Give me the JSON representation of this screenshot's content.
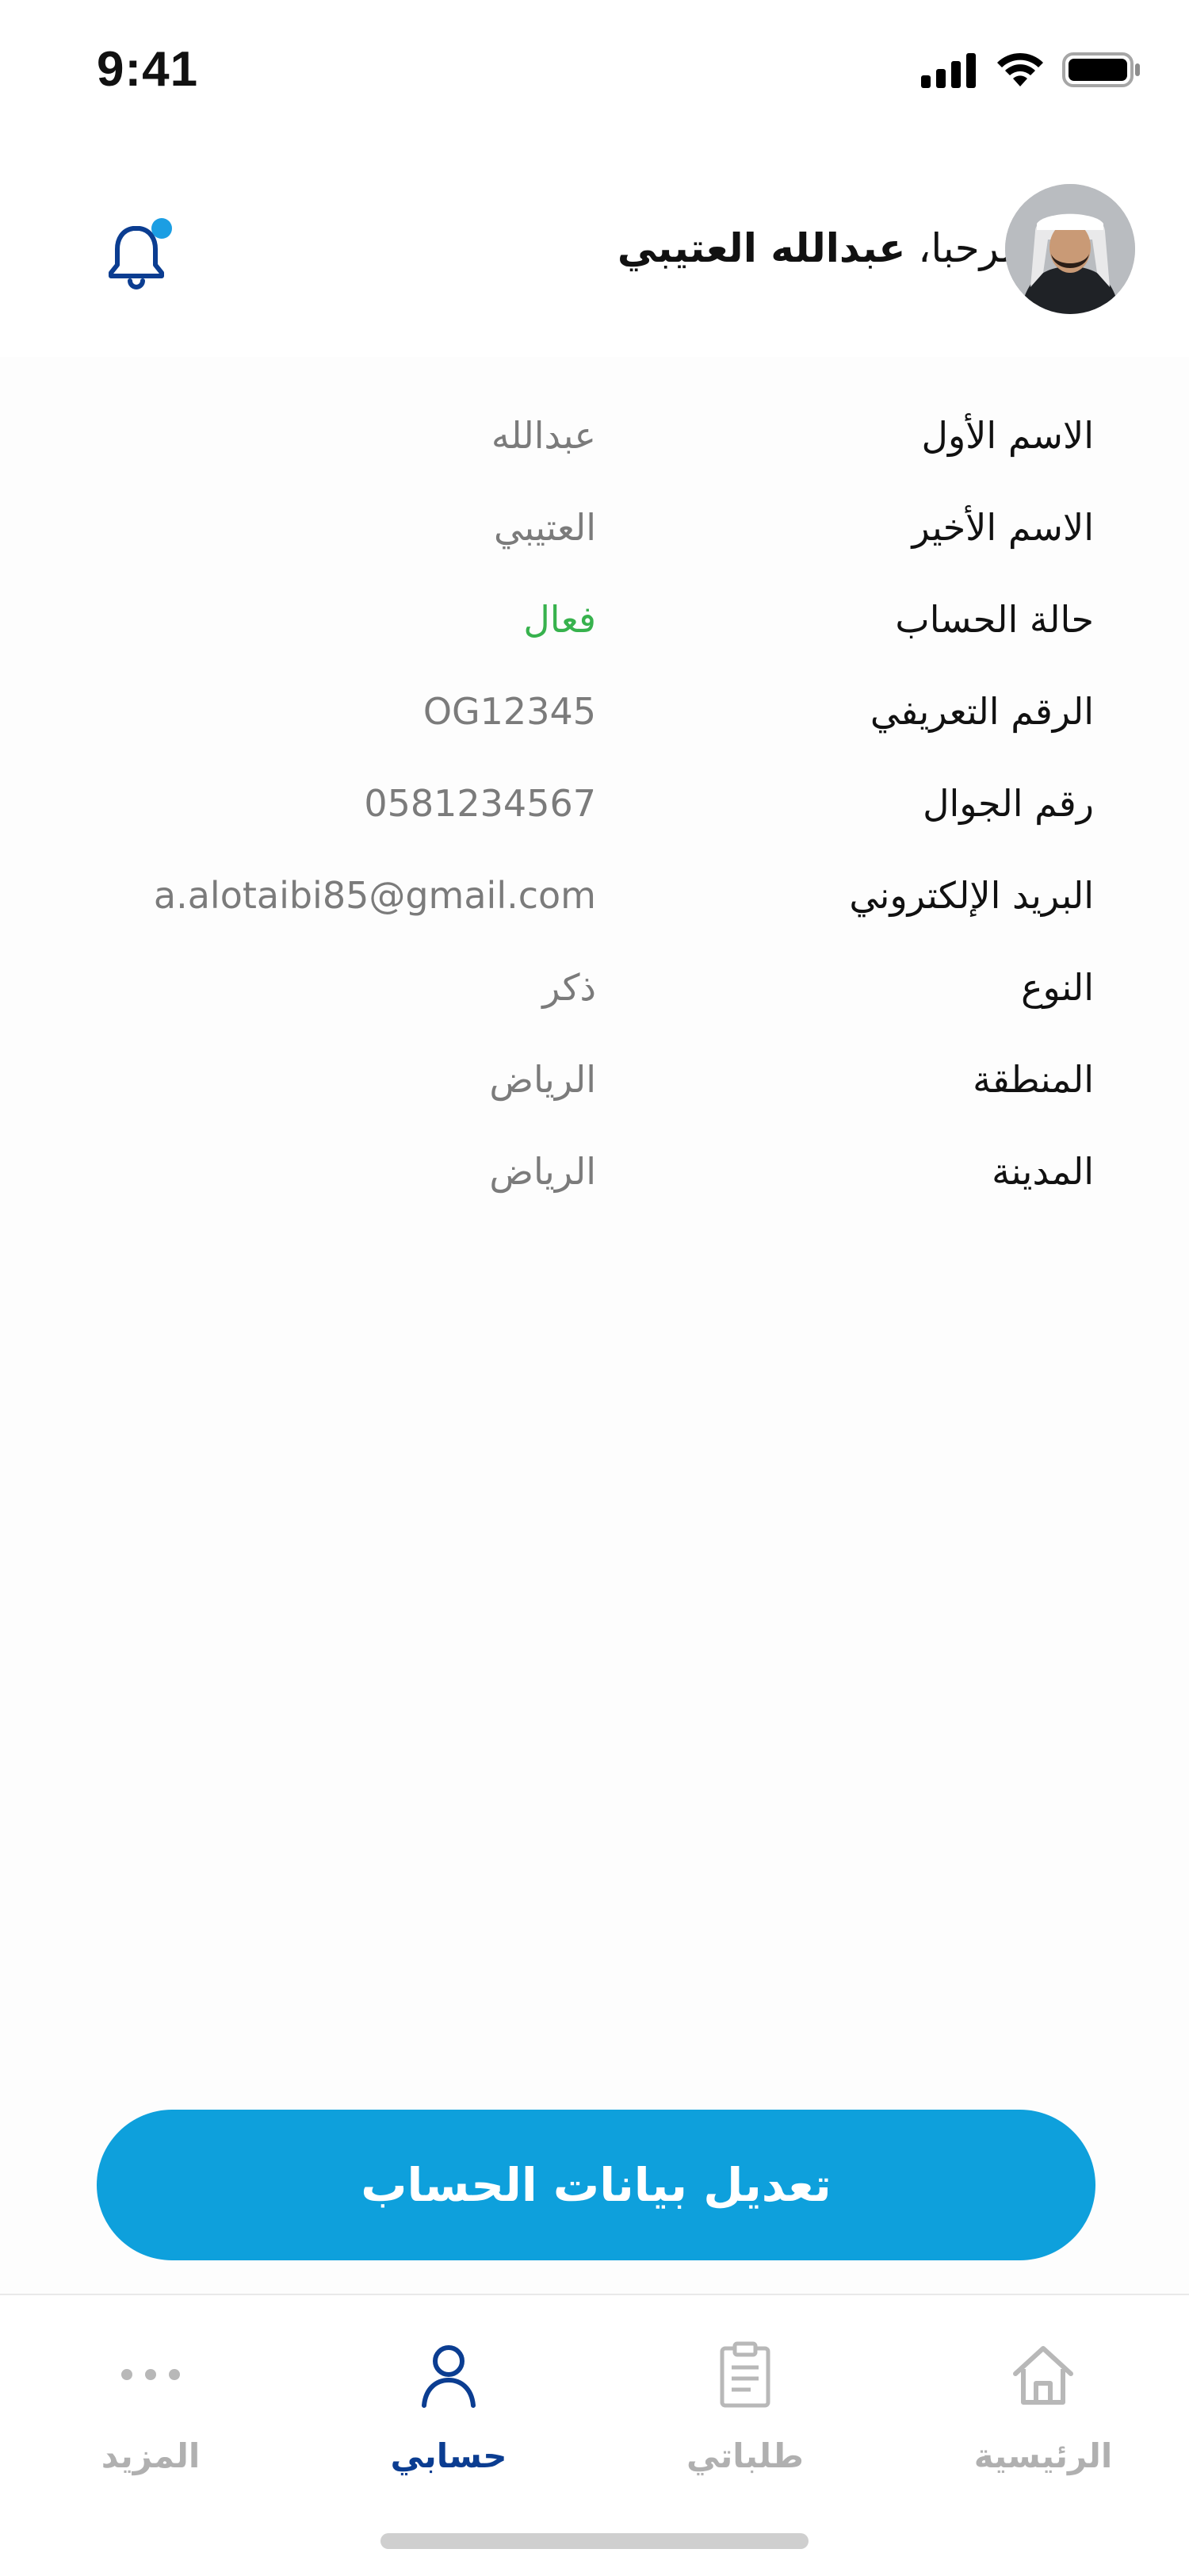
{
  "status_bar": {
    "time": "9:41"
  },
  "header": {
    "greeting_prefix": "مرحبا،",
    "user_name": "عبدالله العتيبي",
    "notification_dot_color": "#1b9ee3"
  },
  "profile": {
    "rows": [
      {
        "label": "الاسم الأول",
        "value": "عبدالله",
        "status": "normal"
      },
      {
        "label": "الاسم الأخير",
        "value": "العتيبي",
        "status": "normal"
      },
      {
        "label": "حالة الحساب",
        "value": "فعال",
        "status": "active"
      },
      {
        "label": "الرقم التعريفي",
        "value": "OG12345",
        "status": "normal"
      },
      {
        "label": "رقم الجوال",
        "value": "0581234567",
        "status": "normal"
      },
      {
        "label": "البريد الإلكتروني",
        "value": "a.alotaibi85@gmail.com",
        "status": "normal"
      },
      {
        "label": "النوع",
        "value": "ذكر",
        "status": "normal"
      },
      {
        "label": "المنطقة",
        "value": "الرياض",
        "status": "normal"
      },
      {
        "label": "المدينة",
        "value": "الرياض",
        "status": "normal"
      }
    ]
  },
  "actions": {
    "edit_account_label": "تعديل بيانات الحساب"
  },
  "tab_bar": {
    "tabs": [
      {
        "label": "المزيد",
        "icon": "more-dots-icon",
        "active": false
      },
      {
        "label": "حسابي",
        "icon": "person-icon",
        "active": true
      },
      {
        "label": "طلباتي",
        "icon": "clipboard-icon",
        "active": false
      },
      {
        "label": "الرئيسية",
        "icon": "home-icon",
        "active": false
      }
    ]
  },
  "colors": {
    "accent": "#0ea0dc",
    "active_tab": "#0b3d91",
    "active_status": "#37b24d",
    "muted_value": "#7b7b7b"
  }
}
